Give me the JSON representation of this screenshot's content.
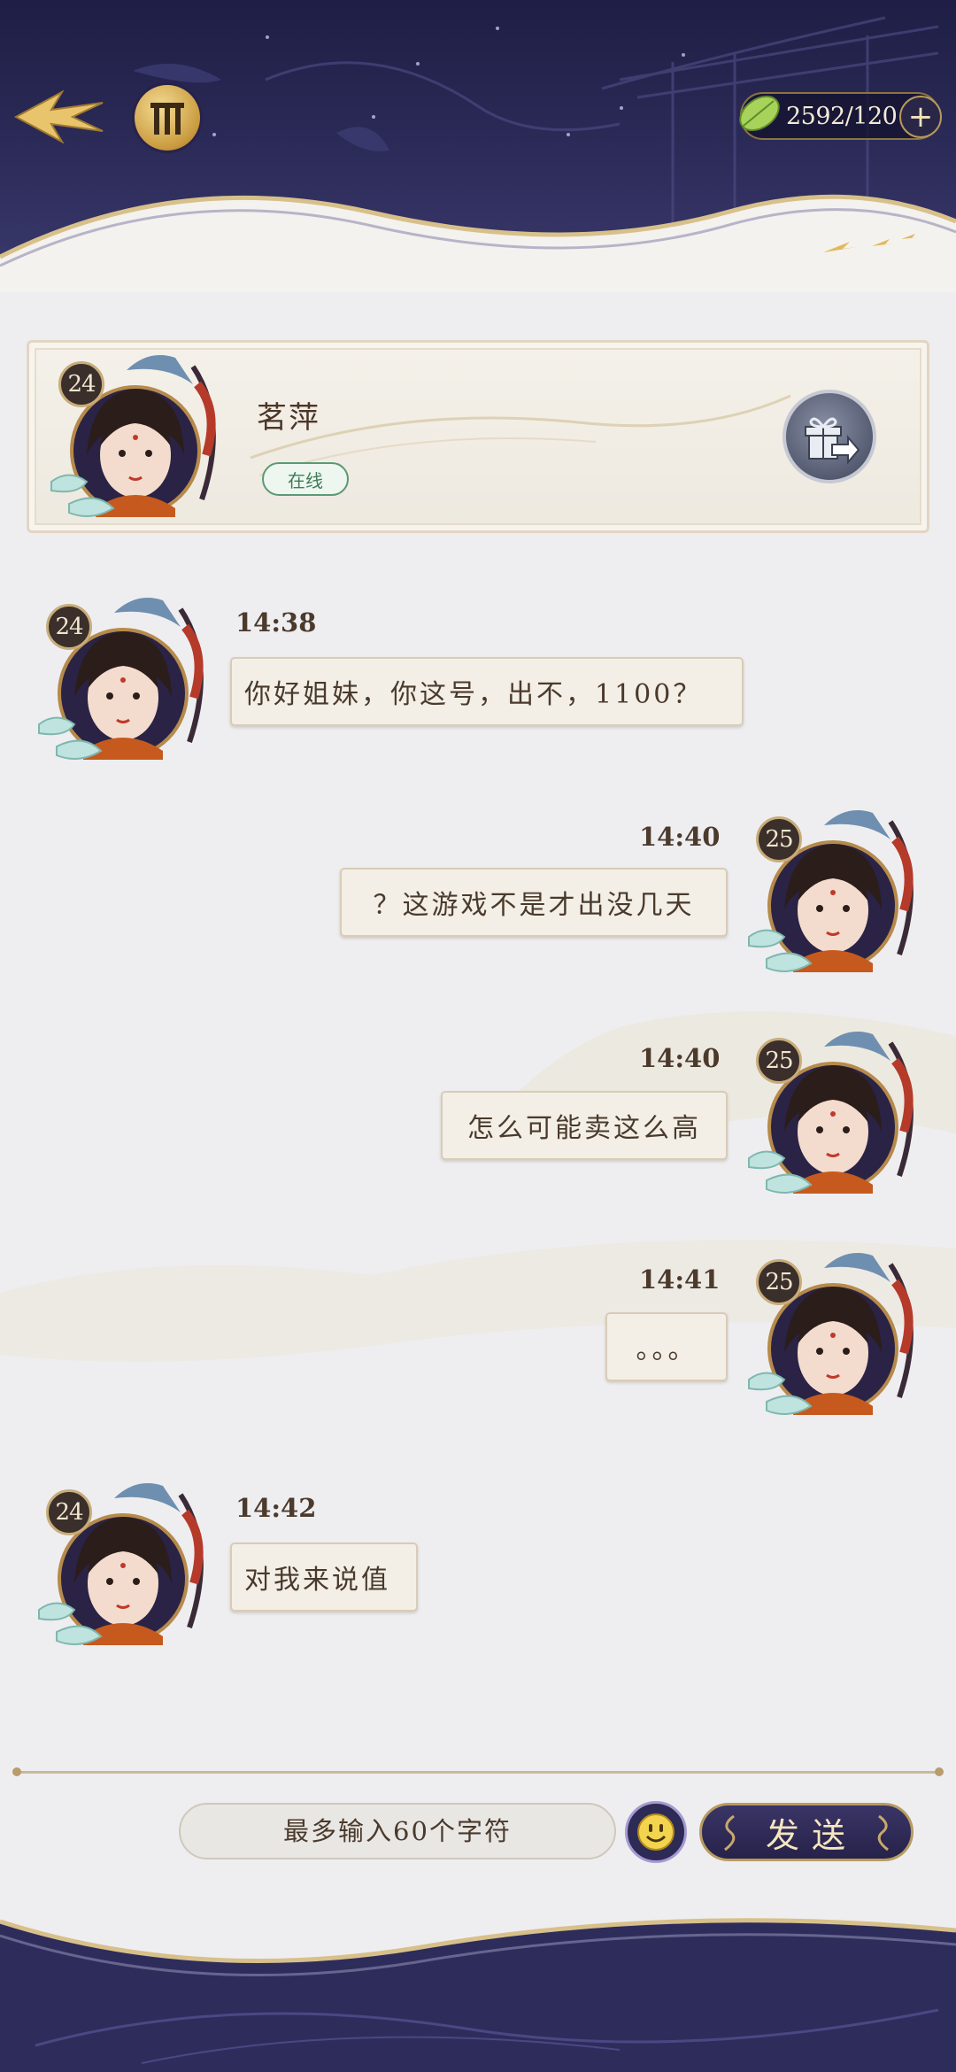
{
  "header": {
    "currency": {
      "value": "2592/120",
      "icon": "jade-leaf-icon",
      "plus": "+"
    }
  },
  "profile": {
    "name": "茗萍",
    "status": "在线",
    "level": "24"
  },
  "messages": [
    {
      "side": "left",
      "time": "14:38",
      "text": "你好姐妹，你这号，出不，1100？",
      "level": "24"
    },
    {
      "side": "right",
      "time": "14:40",
      "text": "？这游戏不是才出没几天",
      "level": "25"
    },
    {
      "side": "right",
      "time": "14:40",
      "text": "怎么可能卖这么高",
      "level": "25"
    },
    {
      "side": "right",
      "time": "14:41",
      "text": "。。。",
      "level": "25"
    },
    {
      "side": "left",
      "time": "14:42",
      "text": "对我来说值",
      "level": "24"
    }
  ],
  "input": {
    "placeholder": "最多输入60个字符"
  },
  "send_label": "发送",
  "colors": {
    "header_navy": "#2d2c5a",
    "gold": "#c99a3e",
    "online_green": "#3e7d56",
    "bubble": "#f3efe6"
  }
}
